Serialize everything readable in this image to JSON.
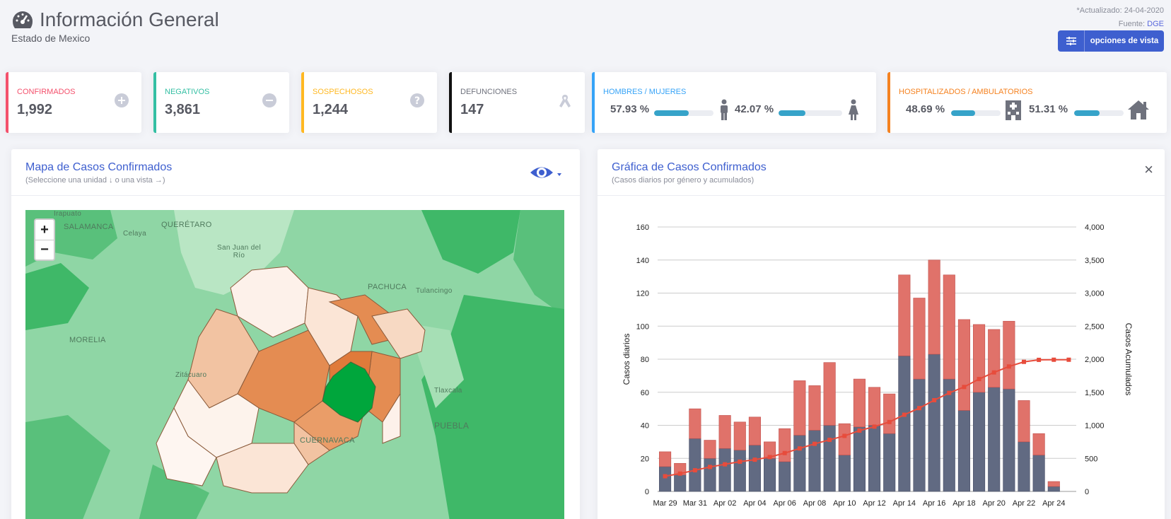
{
  "header": {
    "title": "Información General",
    "subtitle": "Estado de Mexico",
    "updated": "*Actualizado: 24-04-2020",
    "source_label": "Fuente:",
    "source_link": "DGE",
    "view_button": "opciones de vista"
  },
  "stats": {
    "confirmed": {
      "label": "CONFIRMADOS",
      "value": "1,992",
      "color": "#f4516c"
    },
    "negative": {
      "label": "NEGATIVOS",
      "value": "3,861",
      "color": "#34bfa3"
    },
    "suspect": {
      "label": "SOSPECHOSOS",
      "value": "1,244",
      "color": "#ffb822"
    },
    "deaths": {
      "label": "DEFUNCIONES",
      "value": "147",
      "color": "#111111"
    },
    "gender": {
      "label": "HOMBRES / MUJERES",
      "men_pct": "57.93 %",
      "women_pct": "42.07 %",
      "men_fraction": 0.5793,
      "women_fraction": 0.4207,
      "color": "#36a3f7"
    },
    "hospital": {
      "label": "HOSPITALIZADOS / AMBULATORIOS",
      "hosp_pct": "48.69 %",
      "amb_pct": "51.31 %",
      "hosp_fraction": 0.4869,
      "amb_fraction": 0.5131,
      "color": "#f58220"
    }
  },
  "map_panel": {
    "title": "Mapa de Casos Confirmados",
    "subtitle": "(Seleccione una unidad ↓ o una vista →)",
    "zoom_in": "+",
    "zoom_out": "−",
    "labels": {
      "irapuato": "Irapuato",
      "salamanca": "SALAMANCA",
      "celaya": "Celaya",
      "queretaro": "QUERÉTARO",
      "sanjuan": "San Juan del Río",
      "pachuca": "PACHUCA",
      "tulancingo": "Tulancingo",
      "morelia": "MORELIA",
      "zitacuaro": "Zitácuaro",
      "tlaxcala": "Tlaxcala",
      "puebla": "PUEBLA",
      "cuernavaca": "CUERNAVACA"
    }
  },
  "chart_panel": {
    "title": "Gráfica de Casos Confirmados",
    "subtitle": "(Casos diarios por género y acumulados)",
    "close": "×"
  },
  "chart_data": {
    "type": "bar",
    "stacked": true,
    "categories": [
      "Mar 29",
      "Mar 30",
      "Mar 31",
      "Apr 01",
      "Apr 02",
      "Apr 03",
      "Apr 04",
      "Apr 05",
      "Apr 06",
      "Apr 07",
      "Apr 08",
      "Apr 09",
      "Apr 10",
      "Apr 11",
      "Apr 12",
      "Apr 13",
      "Apr 14",
      "Apr 15",
      "Apr 16",
      "Apr 17",
      "Apr 18",
      "Apr 19",
      "Apr 20",
      "Apr 21",
      "Apr 22",
      "Apr 23",
      "Apr 24",
      "Apr 25"
    ],
    "tick_labels": [
      "Mar 29",
      "Mar 31",
      "Apr 02",
      "Apr 04",
      "Apr 06",
      "Apr 08",
      "Apr 10",
      "Apr 12",
      "Apr 14",
      "Apr 16",
      "Apr 18",
      "Apr 20",
      "Apr 22",
      "Apr 24"
    ],
    "series": [
      {
        "values": [
          15,
          10,
          32,
          20,
          26,
          25,
          28,
          20,
          18,
          34,
          37,
          40,
          22,
          39,
          40,
          35,
          82,
          68,
          83,
          68,
          49,
          60,
          63,
          62,
          30,
          22,
          3,
          0
        ],
        "color": "#616a82"
      },
      {
        "values": [
          9,
          7,
          18,
          11,
          20,
          17,
          17,
          10,
          20,
          33,
          27,
          38,
          19,
          29,
          23,
          24,
          49,
          49,
          57,
          63,
          55,
          41,
          35,
          41,
          25,
          13,
          3,
          0
        ],
        "color": "#e0726a"
      },
      {
        "values": [
          230,
          270,
          320,
          370,
          410,
          450,
          480,
          520,
          580,
          650,
          720,
          780,
          840,
          920,
          980,
          1050,
          1160,
          1260,
          1380,
          1490,
          1580,
          1700,
          1800,
          1890,
          1960,
          1990,
          1992,
          1992
        ],
        "color": "#e74c3c",
        "axis": "right"
      }
    ],
    "ylabel": "Casos diarios",
    "y2label": "Casos Acumulados",
    "ylim": [
      0,
      160
    ],
    "y2lim": [
      0,
      4000
    ],
    "yticks": [
      "0",
      "20",
      "40",
      "60",
      "80",
      "100",
      "120",
      "140",
      "160"
    ],
    "y2ticks": [
      "0",
      "500",
      "1,000",
      "1,500",
      "2,000",
      "2,500",
      "3,000",
      "3,500",
      "4,000"
    ],
    "grid": true
  }
}
